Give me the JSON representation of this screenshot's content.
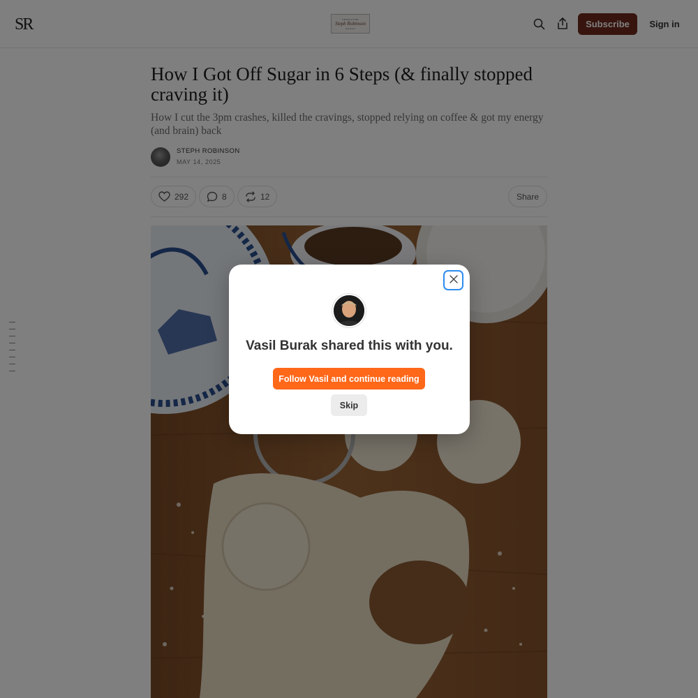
{
  "header": {
    "logo_mark": "SR",
    "badge_top": "NEWSLETTER",
    "badge_script": "Steph Robinson",
    "badge_bottom": "substack",
    "subscribe_label": "Subscribe",
    "signin_label": "Sign in",
    "icons": [
      "search-icon",
      "share-upload-icon"
    ]
  },
  "article": {
    "title": "How I Got Off Sugar in 6 Steps (& finally stopped craving it)",
    "subtitle": "How I cut the 3pm crashes, killed the cravings, stopped relying on coffee & got my energy (and brain) back",
    "author": "STEPH ROBINSON",
    "date": "MAY 14, 2025",
    "likes": "292",
    "comments": "8",
    "restacks": "12",
    "share_label": "Share"
  },
  "modal": {
    "headline": "Vasil Burak shared this with you.",
    "follow_label": "Follow Vasil and continue reading",
    "skip_label": "Skip"
  },
  "colors": {
    "brand": "#6e2a1c",
    "accent": "#ff6719",
    "focus_ring": "#2d8cf0"
  }
}
